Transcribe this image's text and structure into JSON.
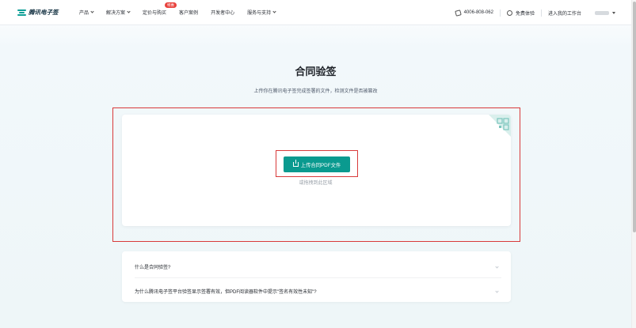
{
  "nav": {
    "logo": "腾讯电子签",
    "menu": [
      {
        "label": "产品",
        "dropdown": true
      },
      {
        "label": "解决方案",
        "dropdown": true
      },
      {
        "label": "定价与购买",
        "dropdown": false,
        "badge": "特惠"
      },
      {
        "label": "客户案例",
        "dropdown": false
      },
      {
        "label": "开发者中心",
        "dropdown": false
      },
      {
        "label": "服务与支持",
        "dropdown": true
      }
    ],
    "phone": "4006-808-062",
    "free_trial": "免费体验",
    "workspace": "进入我的工作台"
  },
  "page": {
    "title": "合同验签",
    "subtitle": "上传你在腾讯电子签完成签署的文件，检测文件是否被篡改",
    "upload_button": "上传合同PDF文件",
    "drag_hint": "或拖拽到此区域"
  },
  "faq": [
    {
      "question": "什么是合同验签?"
    },
    {
      "question": "为什么腾讯电子签平台验签显示签署有效，但PDF阅读器软件中提示\"签名有效性未知\"?"
    }
  ],
  "colors": {
    "accent": "#0a9a8f",
    "highlight": "#d83a3a",
    "badge": "#e8413c"
  }
}
